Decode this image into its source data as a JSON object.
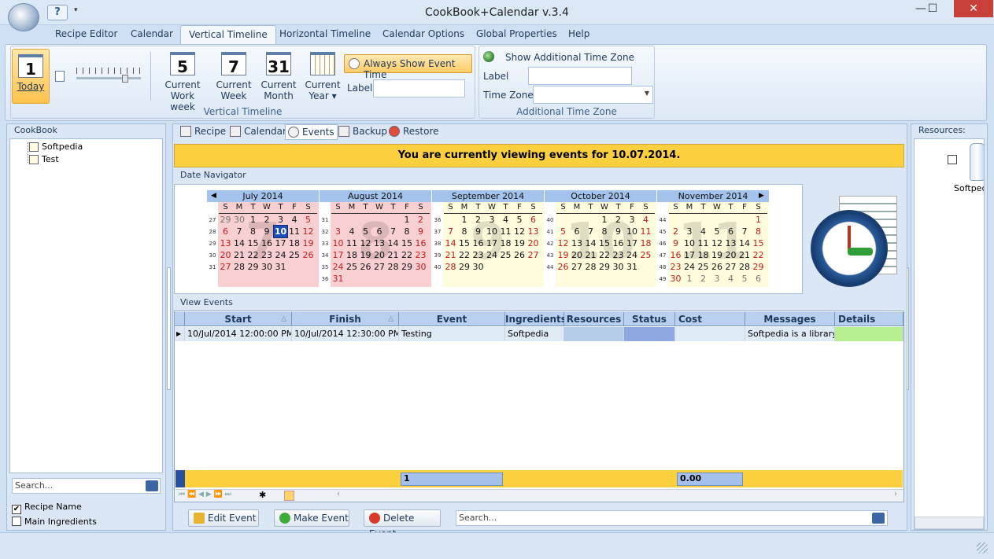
{
  "app": {
    "title": "CookBook+Calendar v.3.4",
    "help_icon": "?",
    "quick_access": "▾"
  },
  "window": {
    "minimize": "—",
    "maximize": "☐",
    "close": "✕"
  },
  "menu": {
    "tabs": [
      {
        "label": "Recipe Editor"
      },
      {
        "label": "Calendar"
      },
      {
        "label": "Vertical Timeline"
      },
      {
        "label": "Horizontal Timeline"
      },
      {
        "label": "Calendar Options"
      },
      {
        "label": "Global Properties"
      },
      {
        "label": "Help"
      }
    ],
    "active": "Vertical Timeline"
  },
  "ribbon": {
    "today": {
      "num": "1",
      "label": "Today"
    },
    "work_week": {
      "num": "5",
      "line1": "Current",
      "line2": "Work week"
    },
    "week": {
      "num": "7",
      "line1": "Current",
      "line2": "Week"
    },
    "month": {
      "num": "31",
      "line1": "Current",
      "line2": "Month"
    },
    "year": {
      "line1": "Current",
      "line2": "Year ▾"
    },
    "always_show": "Always Show Event Time",
    "label_caption": "Label",
    "label_value": "",
    "group1": "Vertical Timeline",
    "show_tz": "Show Additional Time Zone",
    "tz_label_caption": "Label",
    "tz_caption": "Time Zone",
    "tz_value": "",
    "group2": "Additional Time Zone"
  },
  "cookbook": {
    "title": "CookBook",
    "items": [
      {
        "label": "Softpedia"
      },
      {
        "label": "Test"
      }
    ],
    "search_placeholder": "Search...",
    "checks": [
      {
        "label": "Recipe Name",
        "checked": true
      },
      {
        "label": "Main Ingredients",
        "checked": false
      }
    ]
  },
  "resources": {
    "title": "Resources:",
    "item": "Softped"
  },
  "subtabs": [
    {
      "label": "Recipe"
    },
    {
      "label": "Calendar"
    },
    {
      "label": "Events"
    },
    {
      "label": "Backup"
    },
    {
      "label": "Restore"
    }
  ],
  "banner": "You are currently viewing events for 10.07.2014.",
  "date_nav": {
    "title": "Date Navigator",
    "dow": [
      "S",
      "M",
      "T",
      "W",
      "T",
      "F",
      "S"
    ],
    "months": [
      {
        "name": "July 2014",
        "watermark": "7",
        "weeks": [
          "27",
          "28",
          "29",
          "30",
          "31"
        ],
        "days": [
          [
            "29",
            "30",
            "1",
            "2",
            "3",
            "4",
            "5"
          ],
          [
            "6",
            "7",
            "8",
            "9",
            "10",
            "11",
            "12"
          ],
          [
            "13",
            "14",
            "15",
            "16",
            "17",
            "18",
            "19"
          ],
          [
            "20",
            "21",
            "22",
            "23",
            "24",
            "25",
            "26"
          ],
          [
            "27",
            "28",
            "29",
            "30",
            "31",
            "",
            ""
          ]
        ],
        "pink": true
      },
      {
        "name": "August 2014",
        "watermark": "8",
        "weeks": [
          "31",
          "32",
          "33",
          "34",
          "35",
          "36"
        ],
        "days": [
          [
            "",
            "",
            "",
            "",
            "",
            "1",
            "2"
          ],
          [
            "3",
            "4",
            "5",
            "6",
            "7",
            "8",
            "9"
          ],
          [
            "10",
            "11",
            "12",
            "13",
            "14",
            "15",
            "16"
          ],
          [
            "17",
            "18",
            "19",
            "20",
            "21",
            "22",
            "23"
          ],
          [
            "24",
            "25",
            "26",
            "27",
            "28",
            "29",
            "30"
          ],
          [
            "31",
            "",
            "",
            "",
            "",
            "",
            ""
          ]
        ],
        "pink": true
      },
      {
        "name": "September 2014",
        "watermark": "9",
        "weeks": [
          "36",
          "37",
          "38",
          "39",
          "40"
        ],
        "days": [
          [
            "",
            "1",
            "2",
            "3",
            "4",
            "5",
            "6"
          ],
          [
            "7",
            "8",
            "9",
            "10",
            "11",
            "12",
            "13"
          ],
          [
            "14",
            "15",
            "16",
            "17",
            "18",
            "19",
            "20"
          ],
          [
            "21",
            "22",
            "23",
            "24",
            "25",
            "26",
            "27"
          ],
          [
            "28",
            "29",
            "30",
            "",
            "",
            "",
            ""
          ]
        ],
        "pink": false
      },
      {
        "name": "October 2014",
        "watermark": "10",
        "weeks": [
          "40",
          "41",
          "42",
          "43",
          "44"
        ],
        "days": [
          [
            "",
            "",
            "",
            "1",
            "2",
            "3",
            "4"
          ],
          [
            "5",
            "6",
            "7",
            "8",
            "9",
            "10",
            "11"
          ],
          [
            "12",
            "13",
            "14",
            "15",
            "16",
            "17",
            "18"
          ],
          [
            "19",
            "20",
            "21",
            "22",
            "23",
            "24",
            "25"
          ],
          [
            "26",
            "27",
            "28",
            "29",
            "30",
            "31",
            ""
          ]
        ],
        "pink": false
      },
      {
        "name": "November 2014",
        "watermark": "11",
        "weeks": [
          "44",
          "45",
          "46",
          "47",
          "48",
          "49"
        ],
        "days": [
          [
            "",
            "",
            "",
            "",
            "",
            "",
            "1"
          ],
          [
            "2",
            "3",
            "4",
            "5",
            "6",
            "7",
            "8"
          ],
          [
            "9",
            "10",
            "11",
            "12",
            "13",
            "14",
            "15"
          ],
          [
            "16",
            "17",
            "18",
            "19",
            "20",
            "21",
            "22"
          ],
          [
            "23",
            "24",
            "25",
            "26",
            "27",
            "28",
            "29"
          ],
          [
            "30",
            "1",
            "2",
            "3",
            "4",
            "5",
            "6"
          ]
        ],
        "pink": false
      }
    ],
    "selected": "10"
  },
  "view_events": {
    "title": "View Events",
    "columns": [
      "Start",
      "Finish",
      "Event",
      "Ingredients/",
      "Resources",
      "Status",
      "Cost",
      "Messages",
      "Details"
    ],
    "rows": [
      {
        "start": "10/Jul/2014 12:00:00 PM",
        "finish": "10/Jul/2014 12:30:00 PM",
        "event": "Testing",
        "ingredients": "Softpedia",
        "resources": "",
        "status": "",
        "cost": "",
        "messages": "Softpedia is a library of",
        "details": ""
      }
    ],
    "summary_count": "1",
    "summary_cost": "0.00"
  },
  "actions": {
    "edit": "Edit Event",
    "make": "Make Event",
    "delete": "Delete Event",
    "search_placeholder": "Search..."
  }
}
